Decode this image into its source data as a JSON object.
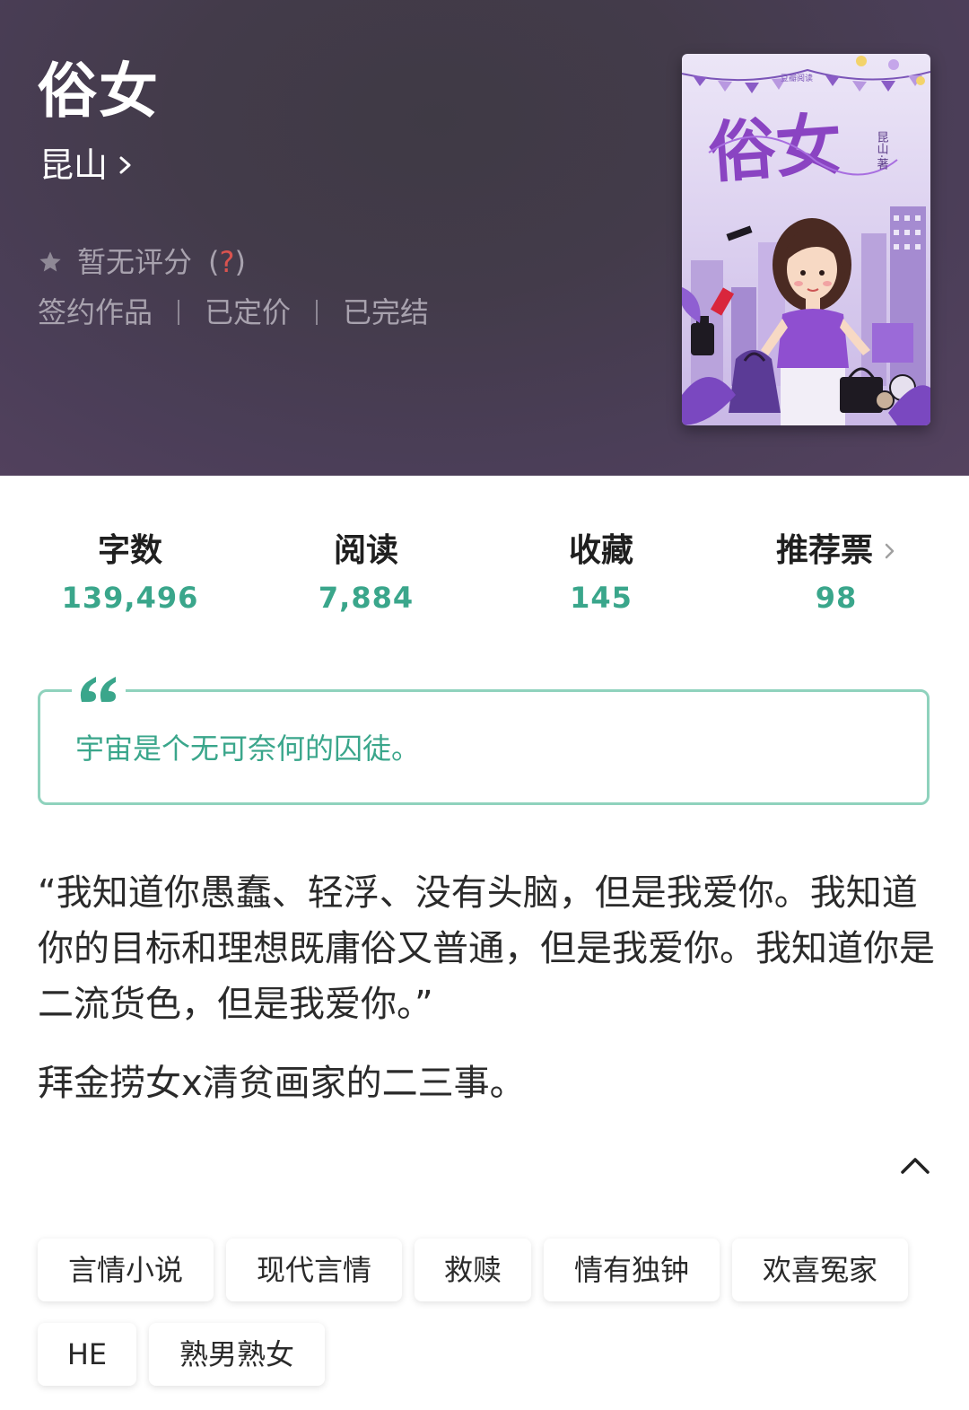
{
  "book": {
    "title": "俗女",
    "author": "昆山",
    "rating_text": "暂无评分",
    "rating_help_open": "(",
    "rating_help_q": "?",
    "rating_help_close": ")",
    "meta": [
      "签约作品",
      "已定价",
      "已完结"
    ],
    "cover": {
      "brand": "豆瓣阅读",
      "title": "俗女",
      "author_line": "昆山·著"
    }
  },
  "stats": [
    {
      "label": "字数",
      "value": "139,496"
    },
    {
      "label": "阅读",
      "value": "7,884"
    },
    {
      "label": "收藏",
      "value": "145"
    },
    {
      "label": "推荐票",
      "value": "98"
    }
  ],
  "quote": {
    "mark": "66",
    "text": "宇宙是个无可奈何的囚徒。"
  },
  "description": {
    "paragraph1": "“我知道你愚蠢、轻浮、没有头脑，但是我爱你。我知道你的目标和理想既庸俗又普通，但是我爱你。我知道你是二流货色，但是我爱你。”",
    "paragraph2": "拜金捞女x清贫画家的二三事。"
  },
  "tags": [
    "言情小说",
    "现代言情",
    "救赎",
    "情有独钟",
    "欢喜冤家",
    "HE",
    "熟男熟女"
  ],
  "colors": {
    "accent": "#3aa68b",
    "quote_border": "#8fd2bd",
    "header_bg": "#45394f"
  }
}
